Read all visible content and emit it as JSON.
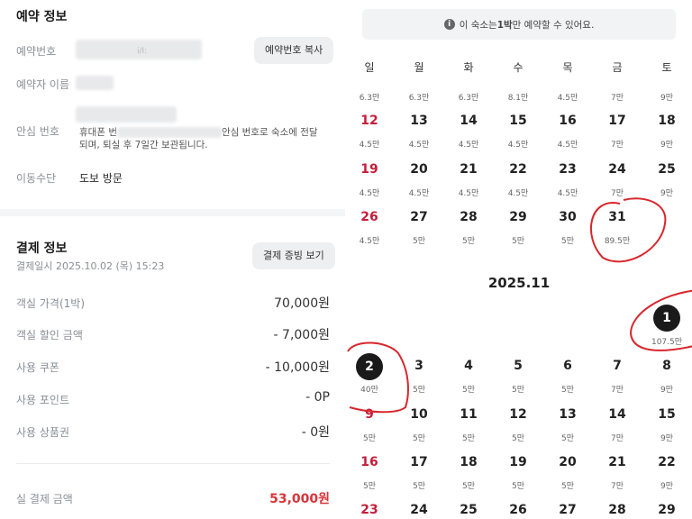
{
  "booking": {
    "title": "예약 정보",
    "number_label": "예약번호",
    "number_fragment": "i/I:",
    "copy_button": "예약번호 복사",
    "name_label": "예약자 이름",
    "safe_label": "안심 번호",
    "safe_note_prefix": "휴대폰 번",
    "safe_note_line1_suffix": "안심 번호로 숙소에 전달",
    "safe_note_line2": "되며, 퇴실 후 7일간 보관됩니다.",
    "transport_label": "이동수단",
    "transport_value": "도보 방문"
  },
  "payment": {
    "title": "결제 정보",
    "date": "결제일시 2025.10.02 (목) 15:23",
    "receipt_button": "결제 증빙 보기",
    "rows": [
      {
        "label": "객실 가격(1박)",
        "value": "70,000원"
      },
      {
        "label": "객실 할인 금액",
        "value": "- 7,000원"
      },
      {
        "label": "사용 쿠폰",
        "value": "- 10,000원"
      },
      {
        "label": "사용 포인트",
        "value": "- 0P"
      },
      {
        "label": "사용 상품권",
        "value": "- 0원"
      }
    ],
    "total_label": "실 결제 금액",
    "total_value": "53,000원",
    "accent": "#d9343a"
  },
  "calendar": {
    "notice_prefix": "이 숙소는 ",
    "notice_bold": "1박",
    "notice_suffix": "만 예약할 수 있어요.",
    "weekdays": [
      "일",
      "월",
      "화",
      "수",
      "목",
      "금",
      "토"
    ],
    "oct_top_prices": [
      "6.3만",
      "6.3만",
      "6.3만",
      "8.1만",
      "4.5만",
      "7만",
      "9만"
    ],
    "oct_rows": [
      {
        "days": [
          "12",
          "13",
          "14",
          "15",
          "16",
          "17",
          "18"
        ],
        "prices": [
          "4.5만",
          "4.5만",
          "4.5만",
          "4.5만",
          "4.5만",
          "7만",
          "9만"
        ]
      },
      {
        "days": [
          "19",
          "20",
          "21",
          "22",
          "23",
          "24",
          "25"
        ],
        "prices": [
          "4.5만",
          "4.5만",
          "4.5만",
          "4.5만",
          "4.5만",
          "7만",
          "9만"
        ]
      },
      {
        "days": [
          "26",
          "27",
          "28",
          "29",
          "30",
          "31"
        ],
        "prices": [
          "4.5만",
          "5만",
          "5만",
          "5만",
          "5만",
          "89.5만"
        ]
      }
    ],
    "nov_title": "2025.11",
    "nov_first": {
      "day": "1",
      "price": "107.5만"
    },
    "nov_rows": [
      {
        "days": [
          "2",
          "3",
          "4",
          "5",
          "6",
          "7",
          "8"
        ],
        "prices": [
          "40만",
          "5만",
          "5만",
          "5만",
          "5만",
          "7만",
          "9만"
        ]
      },
      {
        "days": [
          "9",
          "10",
          "11",
          "12",
          "13",
          "14",
          "15"
        ],
        "prices": [
          "5만",
          "5만",
          "5만",
          "5만",
          "5만",
          "7만",
          "9만"
        ]
      },
      {
        "days": [
          "16",
          "17",
          "18",
          "19",
          "20",
          "21",
          "22"
        ],
        "prices": [
          "5만",
          "5만",
          "5만",
          "5만",
          "5만",
          "7만",
          "9만"
        ]
      },
      {
        "days": [
          "23",
          "24",
          "25",
          "26",
          "27",
          "28",
          "29"
        ],
        "prices": []
      }
    ],
    "sunday_color": "#c41e3a",
    "annotation_color": "#d8262c"
  }
}
